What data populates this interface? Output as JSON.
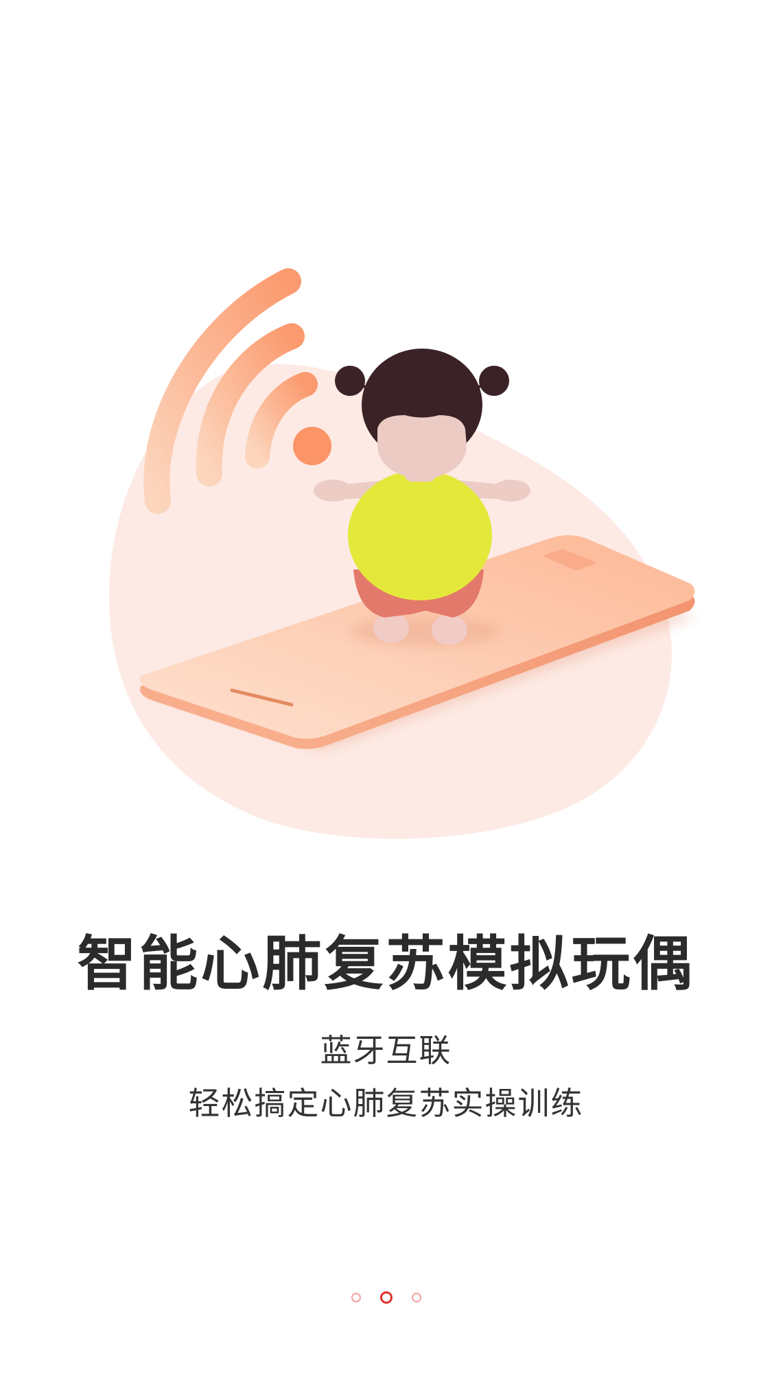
{
  "onboarding": {
    "title": "智能心肺复苏模拟玩偶",
    "subtitle_line1": "蓝牙互联",
    "subtitle_line2": "轻松搞定心肺复苏实操训练",
    "illustration_icon": "bluetooth-doll-phone-illustration",
    "page_indicator": {
      "total": 3,
      "active_index": 1
    }
  },
  "colors": {
    "accent_active_dot": "#e0312b",
    "inactive_dot": "#f2a2a0",
    "title_text": "#2b2b2b",
    "blob_background": "#fdeae4"
  }
}
